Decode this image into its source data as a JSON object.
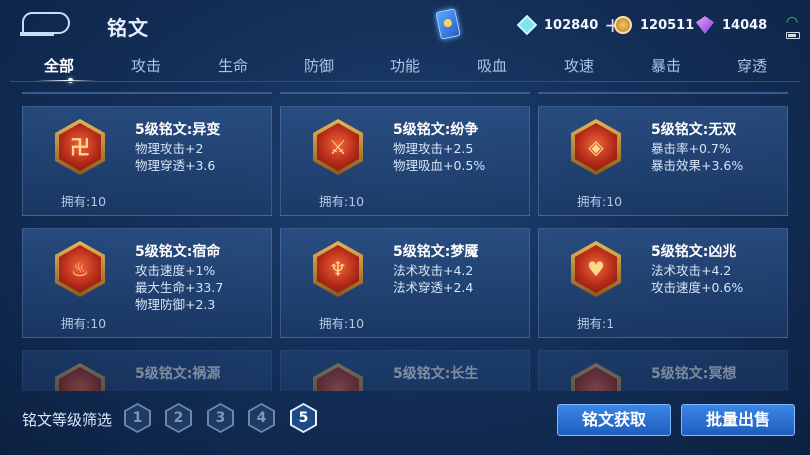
{
  "header": {
    "title": "铭文",
    "currencies": [
      {
        "icon": "crystal-icon",
        "value": "102840"
      },
      {
        "icon": "coin-icon",
        "value": "120511"
      },
      {
        "icon": "gem-icon",
        "value": "14048"
      }
    ]
  },
  "tabs": [
    "全部",
    "攻击",
    "生命",
    "防御",
    "功能",
    "吸血",
    "攻速",
    "暴击",
    "穿透"
  ],
  "runes": [
    {
      "name": "5级铭文:异变",
      "stats": [
        "物理攻击+2",
        "物理穿透+3.6"
      ],
      "owned": "拥有:10",
      "glyph": "卍"
    },
    {
      "name": "5级铭文:纷争",
      "stats": [
        "物理攻击+2.5",
        "物理吸血+0.5%"
      ],
      "owned": "拥有:10",
      "glyph": "⚔"
    },
    {
      "name": "5级铭文:无双",
      "stats": [
        "暴击率+0.7%",
        "暴击效果+3.6%"
      ],
      "owned": "拥有:10",
      "glyph": "◈"
    },
    {
      "name": "5级铭文:宿命",
      "stats": [
        "攻击速度+1%",
        "最大生命+33.7",
        "物理防御+2.3"
      ],
      "owned": "拥有:10",
      "glyph": "♨"
    },
    {
      "name": "5级铭文:梦魇",
      "stats": [
        "法术攻击+4.2",
        "法术穿透+2.4"
      ],
      "owned": "拥有:10",
      "glyph": "♆"
    },
    {
      "name": "5级铭文:凶兆",
      "stats": [
        "法术攻击+4.2",
        "攻击速度+0.6%"
      ],
      "owned": "拥有:1",
      "glyph": "♥"
    },
    {
      "name": "5级铭文:祸源",
      "stats": [],
      "owned": "",
      "glyph": ""
    },
    {
      "name": "5级铭文:长生",
      "stats": [],
      "owned": "",
      "glyph": ""
    },
    {
      "name": "5级铭文:冥想",
      "stats": [],
      "owned": "",
      "glyph": ""
    }
  ],
  "footer": {
    "filter_label": "铭文等级筛选",
    "levels": [
      "1",
      "2",
      "3",
      "4",
      "5"
    ],
    "acquire_label": "铭文获取",
    "sell_label": "批量出售"
  }
}
